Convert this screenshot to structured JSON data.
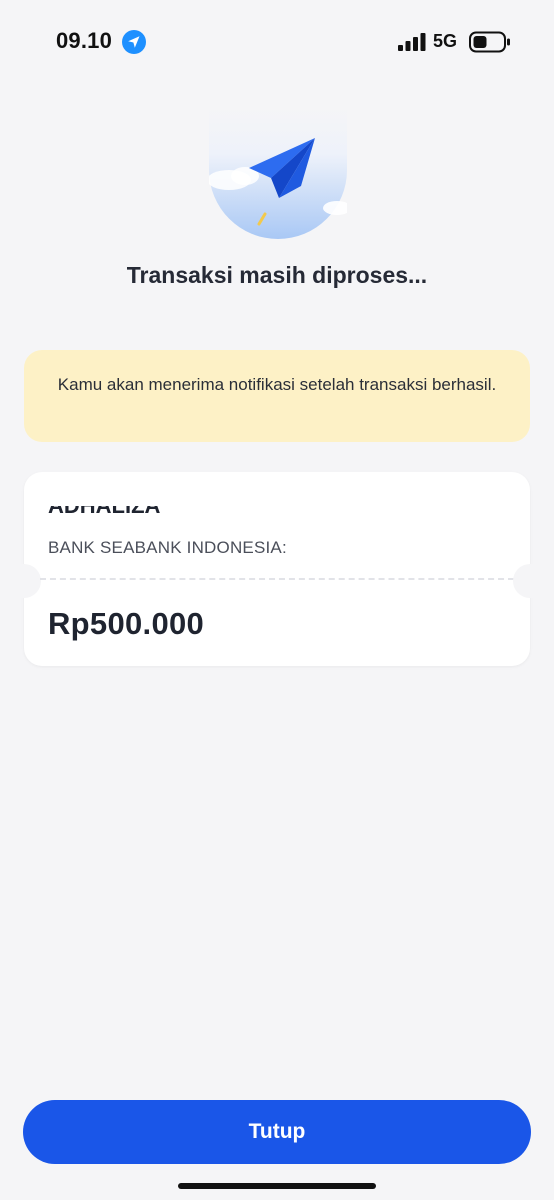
{
  "status_bar": {
    "time": "09.10",
    "network": "5G",
    "icons": [
      "location-arrow-icon",
      "signal-bars-icon",
      "battery-icon"
    ]
  },
  "illustration": {
    "icon": "paper-plane-icon"
  },
  "title": "Transaksi masih diproses...",
  "notice": {
    "text": "Kamu akan menerima notifikasi setelah transaksi berhasil."
  },
  "receipt": {
    "recipient_name": "ADHALIZA",
    "bank": "BANK SEABANK INDONESIA:",
    "amount": "Rp500.000"
  },
  "actions": {
    "close_label": "Tutup"
  },
  "colors": {
    "primary": "#1a56e8",
    "notice_background": "#fdf1c6",
    "background": "#f5f5f7"
  }
}
